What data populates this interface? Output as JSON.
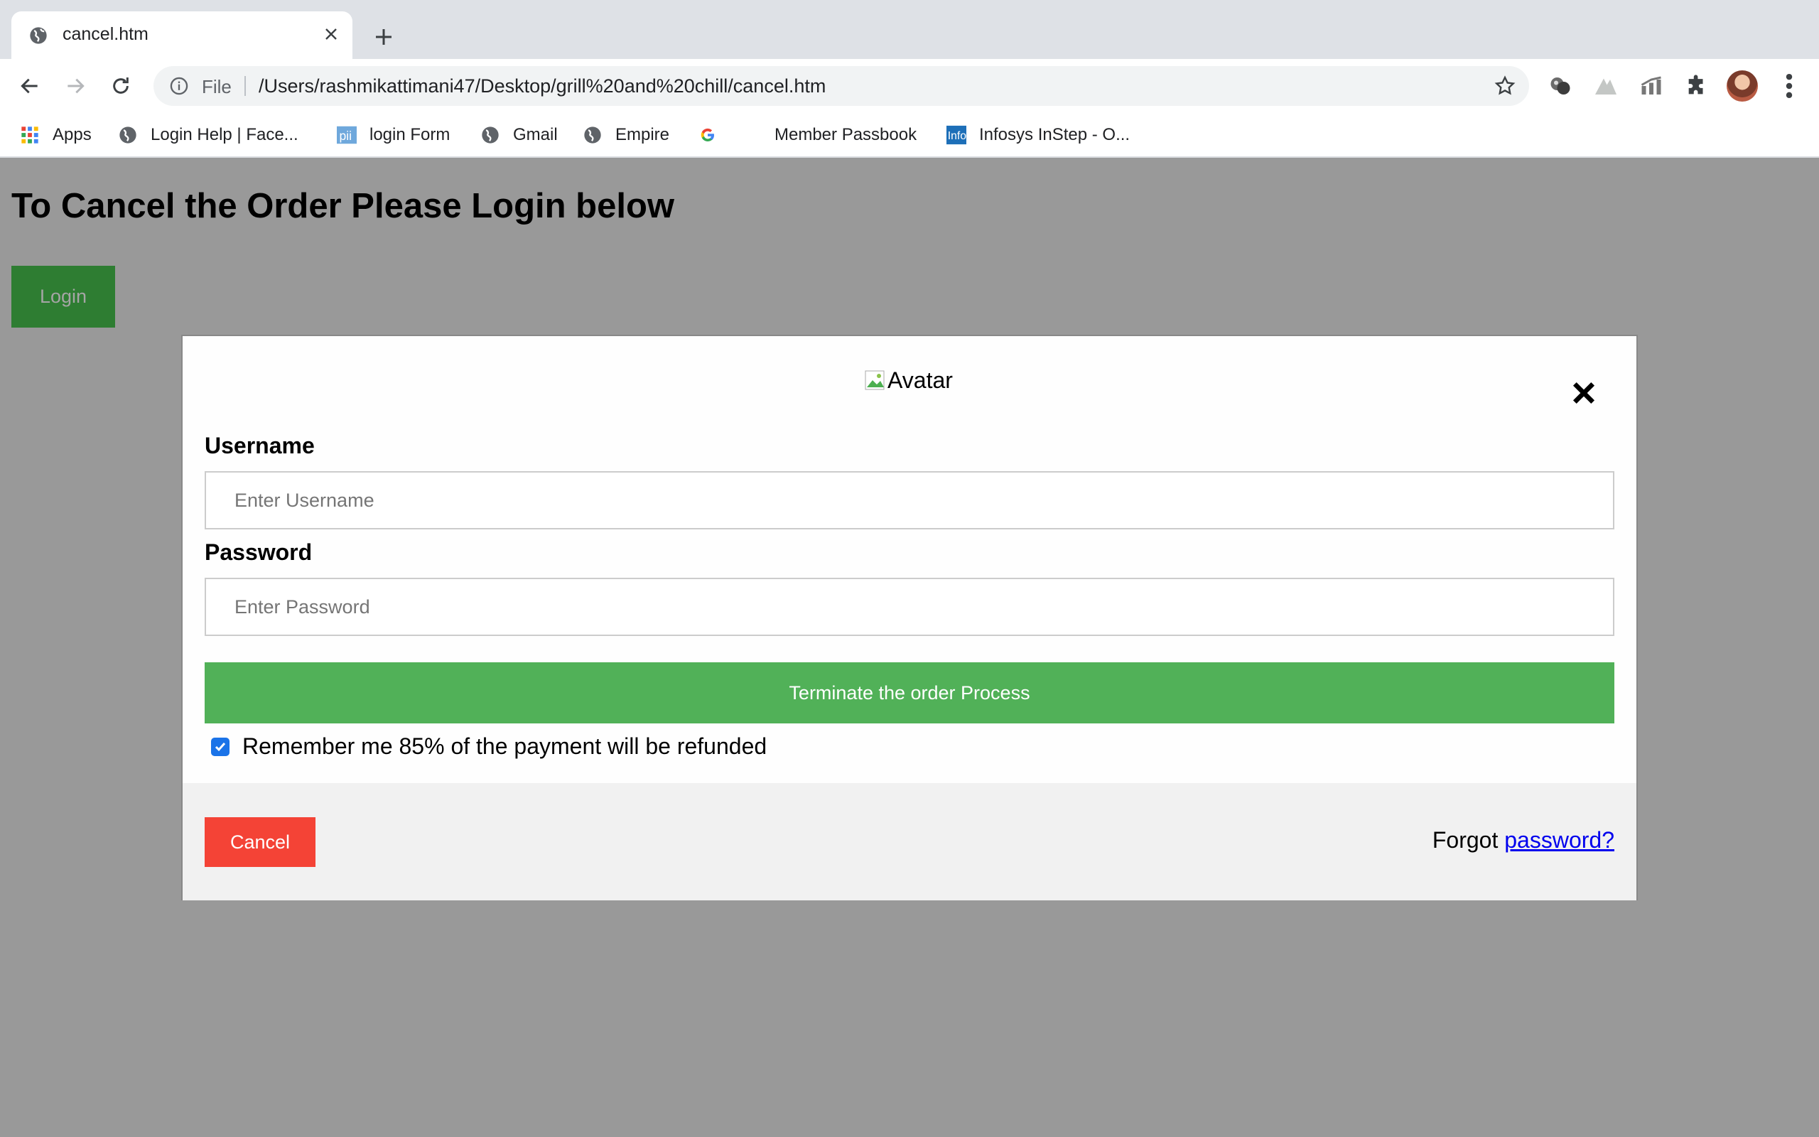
{
  "browser": {
    "tab_title": "cancel.htm",
    "new_tab_icon": "plus-icon",
    "url_scheme": "File",
    "url": "/Users/rashmikattimani47/Desktop/grill%20and%20chill/cancel.htm",
    "bookmarks": [
      {
        "label": "Apps",
        "icon": "apps-grid-icon"
      },
      {
        "label": "Login Help | Face...",
        "icon": "globe-icon"
      },
      {
        "label": "login Form",
        "icon": "pii-icon"
      },
      {
        "label": "Gmail",
        "icon": "globe-icon"
      },
      {
        "label": "Empire",
        "icon": "globe-icon"
      },
      {
        "label": "",
        "icon": "google-icon"
      },
      {
        "label": "Member Passbook",
        "icon": ""
      },
      {
        "label": "Infosys InStep - O...",
        "icon": "infosys-icon"
      }
    ]
  },
  "page": {
    "heading": "To Cancel the Order Please Login below",
    "login_button": "Login"
  },
  "modal": {
    "avatar_alt": "Avatar",
    "username_label": "Username",
    "username_placeholder": "Enter Username",
    "password_label": "Password",
    "password_placeholder": "Enter Password",
    "submit_label": "Terminate the order Process",
    "remember_text": "Remember me 85% of the payment will be refunded",
    "remember_checked": true,
    "cancel_label": "Cancel",
    "forgot_prefix": "Forgot",
    "forgot_link": "password?"
  },
  "colors": {
    "page_background": "#999999",
    "login_button": "#2e7d32",
    "submit_button": "#51b158",
    "cancel_button": "#f44336",
    "link": "#0000ee",
    "checkbox": "#1a73e8"
  }
}
